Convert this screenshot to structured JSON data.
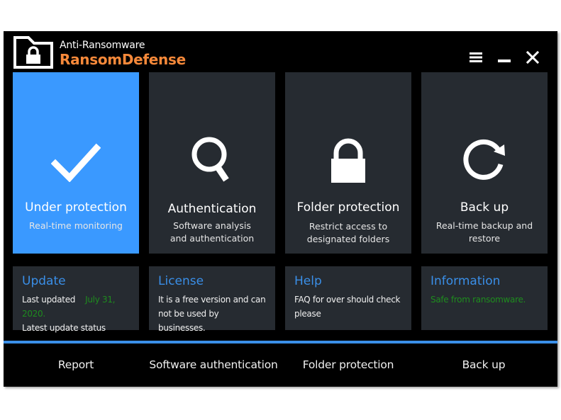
{
  "header": {
    "subtitle": "Anti-Ransomware",
    "title": "RansomDefense",
    "logo_icon": "folder-lock-icon",
    "controls": [
      {
        "name": "menu",
        "icon": "hamburger-menu-icon"
      },
      {
        "name": "minimize",
        "icon": "minimize-icon"
      },
      {
        "name": "close",
        "icon": "close-icon"
      }
    ]
  },
  "tiles": [
    {
      "title": "Under protection",
      "subtitle": "Real-time monitoring",
      "icon": "checkmark-icon",
      "active": true
    },
    {
      "title": "Authentication",
      "subtitle_line1": "Software analysis",
      "subtitle_line2": "and authentication",
      "icon": "magnifier-icon",
      "active": false
    },
    {
      "title": "Folder protection",
      "subtitle_line1": "Restrict access to",
      "subtitle_line2": "designated folders",
      "icon": "padlock-icon",
      "active": false
    },
    {
      "title": "Back up",
      "subtitle": "Real-time backup and restore",
      "icon": "refresh-icon",
      "active": false
    }
  ],
  "cards": {
    "update": {
      "title": "Update",
      "last_updated_label": "Last updated",
      "last_updated_value": "July 31, 2020.",
      "status_label": "Latest update status"
    },
    "license": {
      "title": "License",
      "line1": "It is a free version and can",
      "line2": "not be used by businesses."
    },
    "help": {
      "title": "Help",
      "line1": "FAQ for over should check",
      "line2": "please"
    },
    "information": {
      "title": "Information",
      "status": "Safe from ransomware."
    }
  },
  "bottom_nav": [
    "Report",
    "Software authentication",
    "Folder protection",
    "Back up"
  ],
  "colors": {
    "accent_blue": "#3a99ff",
    "brand_orange": "#f7893a",
    "status_green": "#1e8c1e",
    "tile_bg": "#262b31"
  }
}
